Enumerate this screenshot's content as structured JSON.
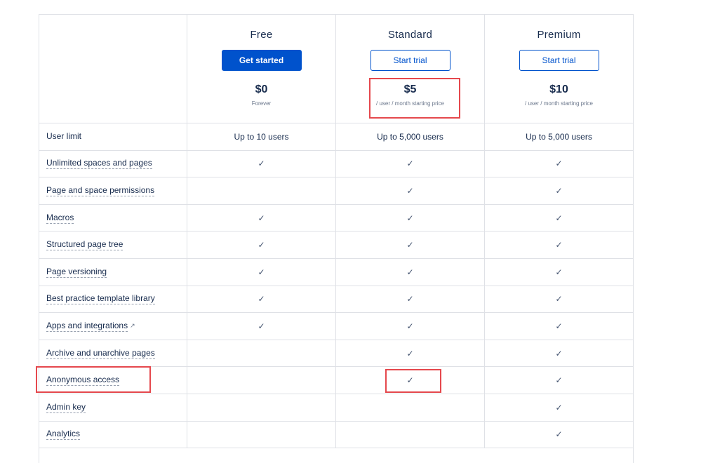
{
  "plans": [
    {
      "name": "Free",
      "button": "Get started",
      "button_style": "primary",
      "price": "$0",
      "note": "Forever"
    },
    {
      "name": "Standard",
      "button": "Start trial",
      "button_style": "secondary",
      "price": "$5",
      "note": "/ user / month starting price"
    },
    {
      "name": "Premium",
      "button": "Start trial",
      "button_style": "secondary",
      "price": "$10",
      "note": "/ user / month starting price"
    }
  ],
  "features": [
    {
      "label": "User limit",
      "dashed": false,
      "values": [
        "Up to 10 users",
        "Up to 5,000 users",
        "Up to 5,000 users"
      ]
    },
    {
      "label": "Unlimited spaces and pages",
      "dashed": true,
      "values": [
        "✓",
        "✓",
        "✓"
      ]
    },
    {
      "label": "Page and space permissions",
      "dashed": true,
      "values": [
        "",
        "✓",
        "✓"
      ]
    },
    {
      "label": "Macros",
      "dashed": true,
      "values": [
        "✓",
        "✓",
        "✓"
      ]
    },
    {
      "label": "Structured page tree",
      "dashed": true,
      "values": [
        "✓",
        "✓",
        "✓"
      ]
    },
    {
      "label": "Page versioning",
      "dashed": true,
      "values": [
        "✓",
        "✓",
        "✓"
      ]
    },
    {
      "label": "Best practice template library",
      "dashed": true,
      "values": [
        "✓",
        "✓",
        "✓"
      ]
    },
    {
      "label": "Apps and integrations",
      "dashed": true,
      "external": "↗",
      "values": [
        "✓",
        "✓",
        "✓"
      ]
    },
    {
      "label": "Archive and unarchive pages",
      "dashed": true,
      "values": [
        "",
        "✓",
        "✓"
      ]
    },
    {
      "label": "Anonymous access",
      "dashed": true,
      "values": [
        "",
        "✓",
        "✓"
      ]
    },
    {
      "label": "Admin key",
      "dashed": true,
      "values": [
        "",
        "",
        "✓"
      ]
    },
    {
      "label": "Analytics",
      "dashed": true,
      "values": [
        "",
        "",
        "✓"
      ]
    }
  ],
  "colors": {
    "accent": "#0052cc",
    "highlight": "#e5484d",
    "border": "#dfe1e6",
    "text": "#172b4d"
  }
}
